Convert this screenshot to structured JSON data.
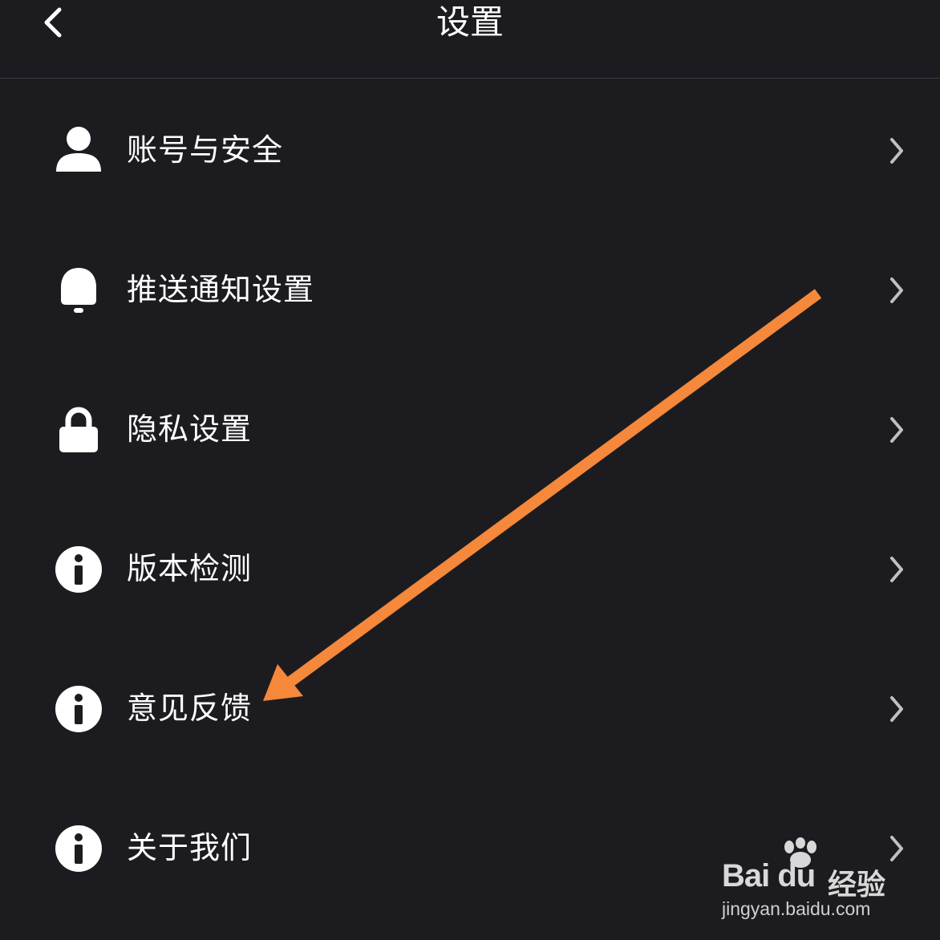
{
  "header": {
    "title": "设置"
  },
  "menu": {
    "items": [
      {
        "label": "账号与安全",
        "icon": "user-icon"
      },
      {
        "label": "推送通知设置",
        "icon": "bell-icon"
      },
      {
        "label": "隐私设置",
        "icon": "lock-icon"
      },
      {
        "label": "版本检测",
        "icon": "info-icon"
      },
      {
        "label": "意见反馈",
        "icon": "info-icon"
      },
      {
        "label": "关于我们",
        "icon": "info-icon"
      }
    ]
  },
  "annotation": {
    "arrow_color": "#f5883a",
    "points_to": "意见反馈"
  },
  "watermark": {
    "brand": "Bai du",
    "product": "经验",
    "url": "jingyan.baidu.com"
  },
  "colors": {
    "background": "#1c1c20",
    "text": "#ffffff",
    "chevron": "#bfbfc4",
    "divider": "#3a3a40"
  }
}
